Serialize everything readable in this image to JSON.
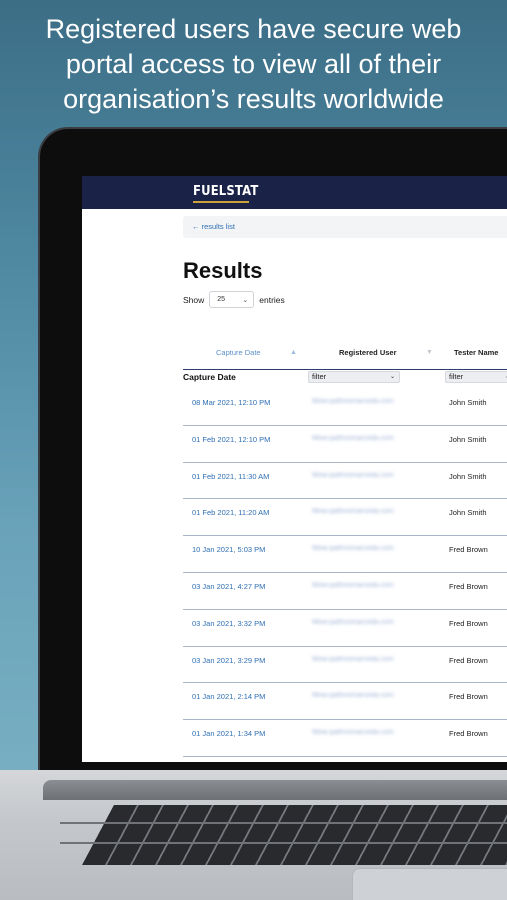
{
  "headline": {
    "line1": "Registered users have secure web",
    "line2": "portal access to view all of their",
    "line3": "organisation’s results worldwide"
  },
  "app": {
    "logo": "FUELSTAT",
    "breadcrumb": "← results list",
    "title": "Results",
    "show_label": "Show",
    "entries_value": "25",
    "entries_label": "entries"
  },
  "table": {
    "columns": [
      "Capture Date",
      "Registered User",
      "Tester Name"
    ],
    "filter_label": "Capture Date",
    "filter_placeholder": "filter",
    "rows": [
      {
        "date": "08 Mar 2021, 12:10 PM",
        "user": "fillow-pathnomarceda.com",
        "tester": "John Smith"
      },
      {
        "date": "01 Feb 2021, 12:10 PM",
        "user": "fillow-pathnomarceda.com",
        "tester": "John Smith"
      },
      {
        "date": "01 Feb 2021, 11:30 AM",
        "user": "fillow-pathnomarceda.com",
        "tester": "John Smith"
      },
      {
        "date": "01 Feb 2021, 11:20 AM",
        "user": "fillow-pathnomarceda.com",
        "tester": "John Smith"
      },
      {
        "date": "10 Jan 2021, 5:03 PM",
        "user": "fillow-pathnomarceda.com",
        "tester": "Fred Brown"
      },
      {
        "date": "03 Jan 2021, 4:27 PM",
        "user": "fillow-pathnomarceda.com",
        "tester": "Fred Brown"
      },
      {
        "date": "03 Jan 2021, 3:32 PM",
        "user": "fillow-pathnomarceda.com",
        "tester": "Fred Brown"
      },
      {
        "date": "03 Jan 2021, 3:29 PM",
        "user": "fillow-pathnomarceda.com",
        "tester": "Fred Brown"
      },
      {
        "date": "01 Jan 2021, 2:14 PM",
        "user": "fillow-pathnomarceda.com",
        "tester": "Fred Brown"
      },
      {
        "date": "01 Jan 2021, 1:34 PM",
        "user": "fillow-pathnomarceda.com",
        "tester": "Fred Brown"
      }
    ]
  },
  "colors": {
    "navbar": "#1a2347",
    "logo_accent": "#c9a23a",
    "link": "#2f6fb3",
    "background_top": "#3c6e86",
    "background_bottom": "#7fb4c6"
  }
}
